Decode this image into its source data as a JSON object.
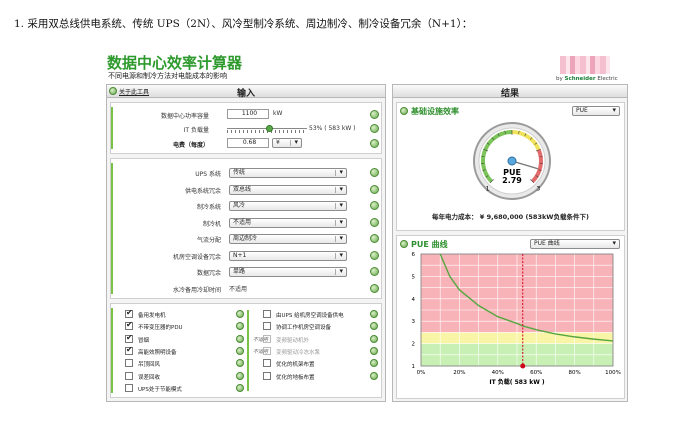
{
  "intro": "1.  采用双总线供电系统、传统 UPS（2N）、风冷型制冷系统、周边制冷、制冷设备冗余（N+1）：",
  "app": {
    "title": "数据中心效率计算器",
    "subtitle": "不同电源和制冷方法对电能成本的影响",
    "logo_by": "by",
    "logo_brand": "Schneider",
    "logo_suffix": "Electric"
  },
  "input": {
    "title": "输入",
    "about": "关于此工具",
    "power_label": "数据中心功率容量",
    "power_value": "1100",
    "power_unit": "kW",
    "it_load_label": "IT 负载量",
    "it_load_percent": 53,
    "it_load_text": "53% ( 583 kW )",
    "price_label": "电费（每度）",
    "price_value": "0.68",
    "currency": "¥",
    "config": [
      {
        "label": "UPS 系统",
        "value": "传统",
        "type": "select"
      },
      {
        "label": "供电系统冗余",
        "value": "双总线",
        "type": "select"
      },
      {
        "label": "制冷系统",
        "value": "风冷",
        "type": "select"
      },
      {
        "label": "制冷机",
        "value": "不适用",
        "type": "select"
      },
      {
        "label": "气流分配",
        "value": "周边制冷",
        "type": "select"
      },
      {
        "label": "机房空调设备冗余",
        "value": "N+1",
        "type": "select"
      },
      {
        "label": "数据冗余",
        "value": "单路",
        "type": "select"
      },
      {
        "label": "水冷备用冷却时间",
        "value": "不适用",
        "type": "text"
      }
    ],
    "checks_left": [
      {
        "label": "备用发电机",
        "checked": true
      },
      {
        "label": "不带变压器的PDU",
        "checked": true
      },
      {
        "label": "冒烟",
        "checked": true
      },
      {
        "label": "高能效照明设备",
        "checked": true
      },
      {
        "label": "吊顶回风",
        "checked": false
      },
      {
        "label": "误差回收",
        "checked": false
      },
      {
        "label": "UPS处于节能模式",
        "checked": false
      }
    ],
    "checks_right": [
      {
        "label": "由UPS 给机房空调设备供电",
        "checked": false,
        "na": "",
        "disabled": false
      },
      {
        "label": "协调工作机房空调设备",
        "checked": false,
        "na": "",
        "disabled": false
      },
      {
        "label": "变频驱动机外",
        "checked": false,
        "na": "不适用",
        "disabled": true
      },
      {
        "label": "变频驱动冷冻水泵",
        "checked": false,
        "na": "不适用",
        "disabled": true
      },
      {
        "label": "优化的机架布置",
        "checked": false,
        "na": "",
        "disabled": false
      },
      {
        "label": "优化的地板布置",
        "checked": false,
        "na": "",
        "disabled": false
      }
    ]
  },
  "result": {
    "title": "结果",
    "efficiency_title": "基础设施效率",
    "metric_select": "PUE",
    "gauge": {
      "label": "PUE",
      "value": 2.79,
      "value_text": "2.79",
      "min": 1,
      "max": 3,
      "min_label": "1",
      "max_label": "3"
    },
    "cost_text": "每年电力成本：  ¥ 9,680,000 (583kW负载条件下)",
    "curve_title": "PUE 曲线",
    "curve_select": "PUE 曲线"
  },
  "chart_data": {
    "type": "area",
    "xlabel": "IT 负载( 583 kW )",
    "ylabel": "",
    "x_ticks": [
      "0%",
      "20%",
      "40%",
      "60%",
      "80%",
      "100%"
    ],
    "y_ticks": [
      "1",
      "2",
      "3",
      "4",
      "5",
      "6"
    ],
    "xlim": [
      0,
      100
    ],
    "ylim": [
      1,
      6
    ],
    "zones": [
      {
        "from": 1,
        "to": 2,
        "color": "#c8f0b4"
      },
      {
        "from": 2,
        "to": 2.5,
        "color": "#f8f5a6"
      },
      {
        "from": 2.5,
        "to": 6,
        "color": "#f7b3b8"
      }
    ],
    "series": [
      {
        "x": [
          10,
          15,
          20,
          30,
          40,
          50,
          53,
          60,
          70,
          80,
          90,
          100
        ],
        "y": [
          6.0,
          5.0,
          4.4,
          3.7,
          3.2,
          2.9,
          2.79,
          2.62,
          2.43,
          2.3,
          2.2,
          2.12
        ],
        "color": "#57a640"
      }
    ],
    "marker_x": 53,
    "marker_y": 2.79,
    "marker_color": "#d0021b"
  }
}
